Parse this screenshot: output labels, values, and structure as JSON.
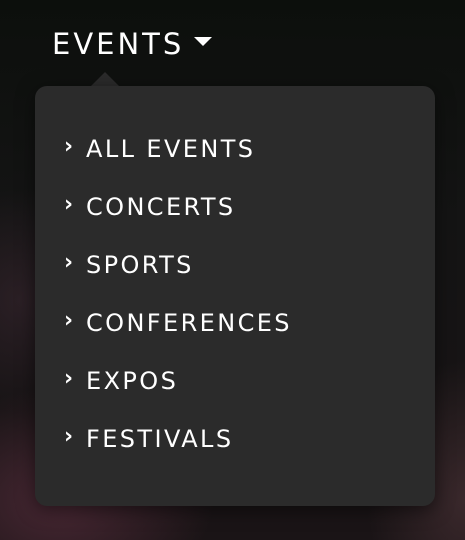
{
  "nav": {
    "label": "EVENTS",
    "caret_icon": "caret-down-icon"
  },
  "menu": {
    "bullet_icon": "chevron-right-icon",
    "bullet_glyph": "›",
    "items": [
      {
        "label": "ALL EVENTS"
      },
      {
        "label": "CONCERTS"
      },
      {
        "label": "SPORTS"
      },
      {
        "label": "CONFERENCES"
      },
      {
        "label": "EXPOS"
      },
      {
        "label": "FESTIVALS"
      }
    ]
  },
  "colors": {
    "menu_background": "#2b2b2b",
    "text": "#ffffff",
    "page_background": "#0c0f0c"
  }
}
